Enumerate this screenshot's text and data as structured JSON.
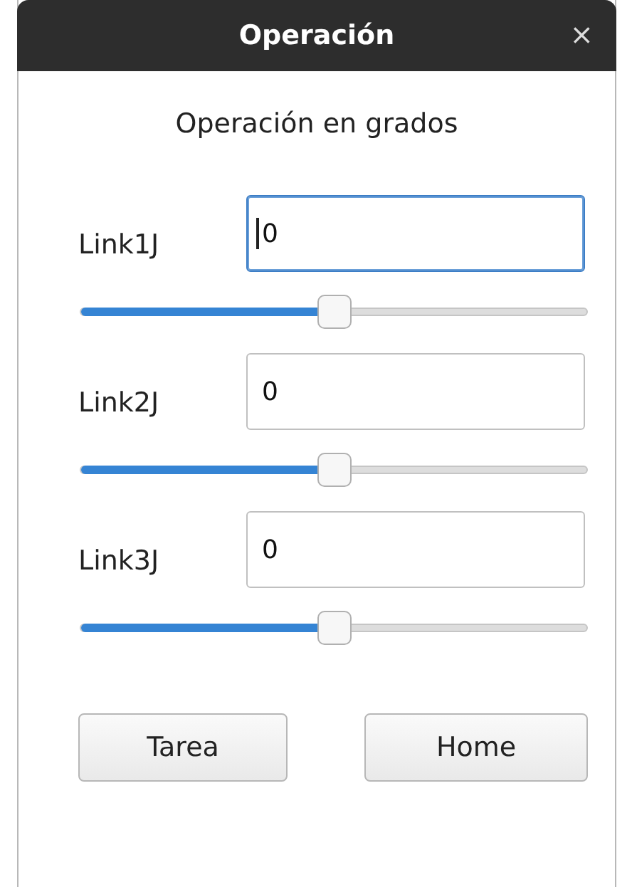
{
  "window": {
    "title": "Operación",
    "close": "×"
  },
  "heading": "Operación en grados",
  "links": [
    {
      "label": "Link1J",
      "value": "0",
      "focused": true,
      "level": 0.5
    },
    {
      "label": "Link2J",
      "value": "0",
      "focused": false,
      "level": 0.5
    },
    {
      "label": "Link3J",
      "value": "0",
      "focused": false,
      "level": 0.5
    }
  ],
  "buttons": [
    "Tarea",
    "Home"
  ]
}
